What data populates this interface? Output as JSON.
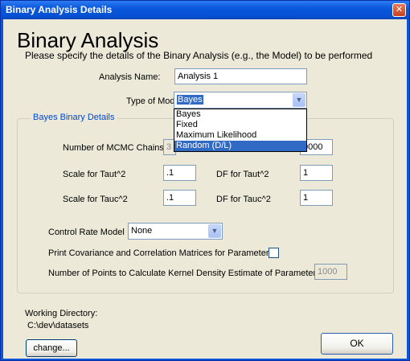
{
  "window": {
    "title": "Binary Analysis Details"
  },
  "header": {
    "title": "Binary Analysis",
    "subtitle": "Please specify the details of the Binary Analysis (e.g., the Model) to be performed"
  },
  "analysis_name": {
    "label": "Analysis Name:",
    "value": "Analysis 1"
  },
  "model_type": {
    "label": "Type of Model",
    "value": "Bayes",
    "options": [
      "Bayes",
      "Fixed",
      "Maximum Likelihood",
      "Random (D/L)"
    ],
    "highlighted": "Random (D/L)"
  },
  "group": {
    "title": "Bayes Binary Details",
    "mcmc_chains": {
      "label": "Number of MCMC Chains",
      "value": "3",
      "right_value": "0000"
    },
    "scale_taut": {
      "label": "Scale for Taut^2",
      "value": ".1"
    },
    "df_taut": {
      "label": "DF for Taut^2",
      "value": "1"
    },
    "scale_tauc": {
      "label": "Scale for Tauc^2",
      "value": ".1"
    },
    "df_tauc": {
      "label": "DF for Tauc^2",
      "value": "1"
    },
    "control_rate": {
      "label": "Control Rate Model",
      "value": "None"
    },
    "print_cov": {
      "label": "Print Covariance and Correlation Matrices for Parameters",
      "checked": false
    },
    "kernel_points": {
      "label": "Number of Points to Calculate Kernel Density Estimate of Parameters",
      "value": "1000"
    }
  },
  "working_dir": {
    "label": "Working Directory:",
    "path": "C:\\dev\\datasets"
  },
  "buttons": {
    "change": "change...",
    "ok": "OK"
  }
}
